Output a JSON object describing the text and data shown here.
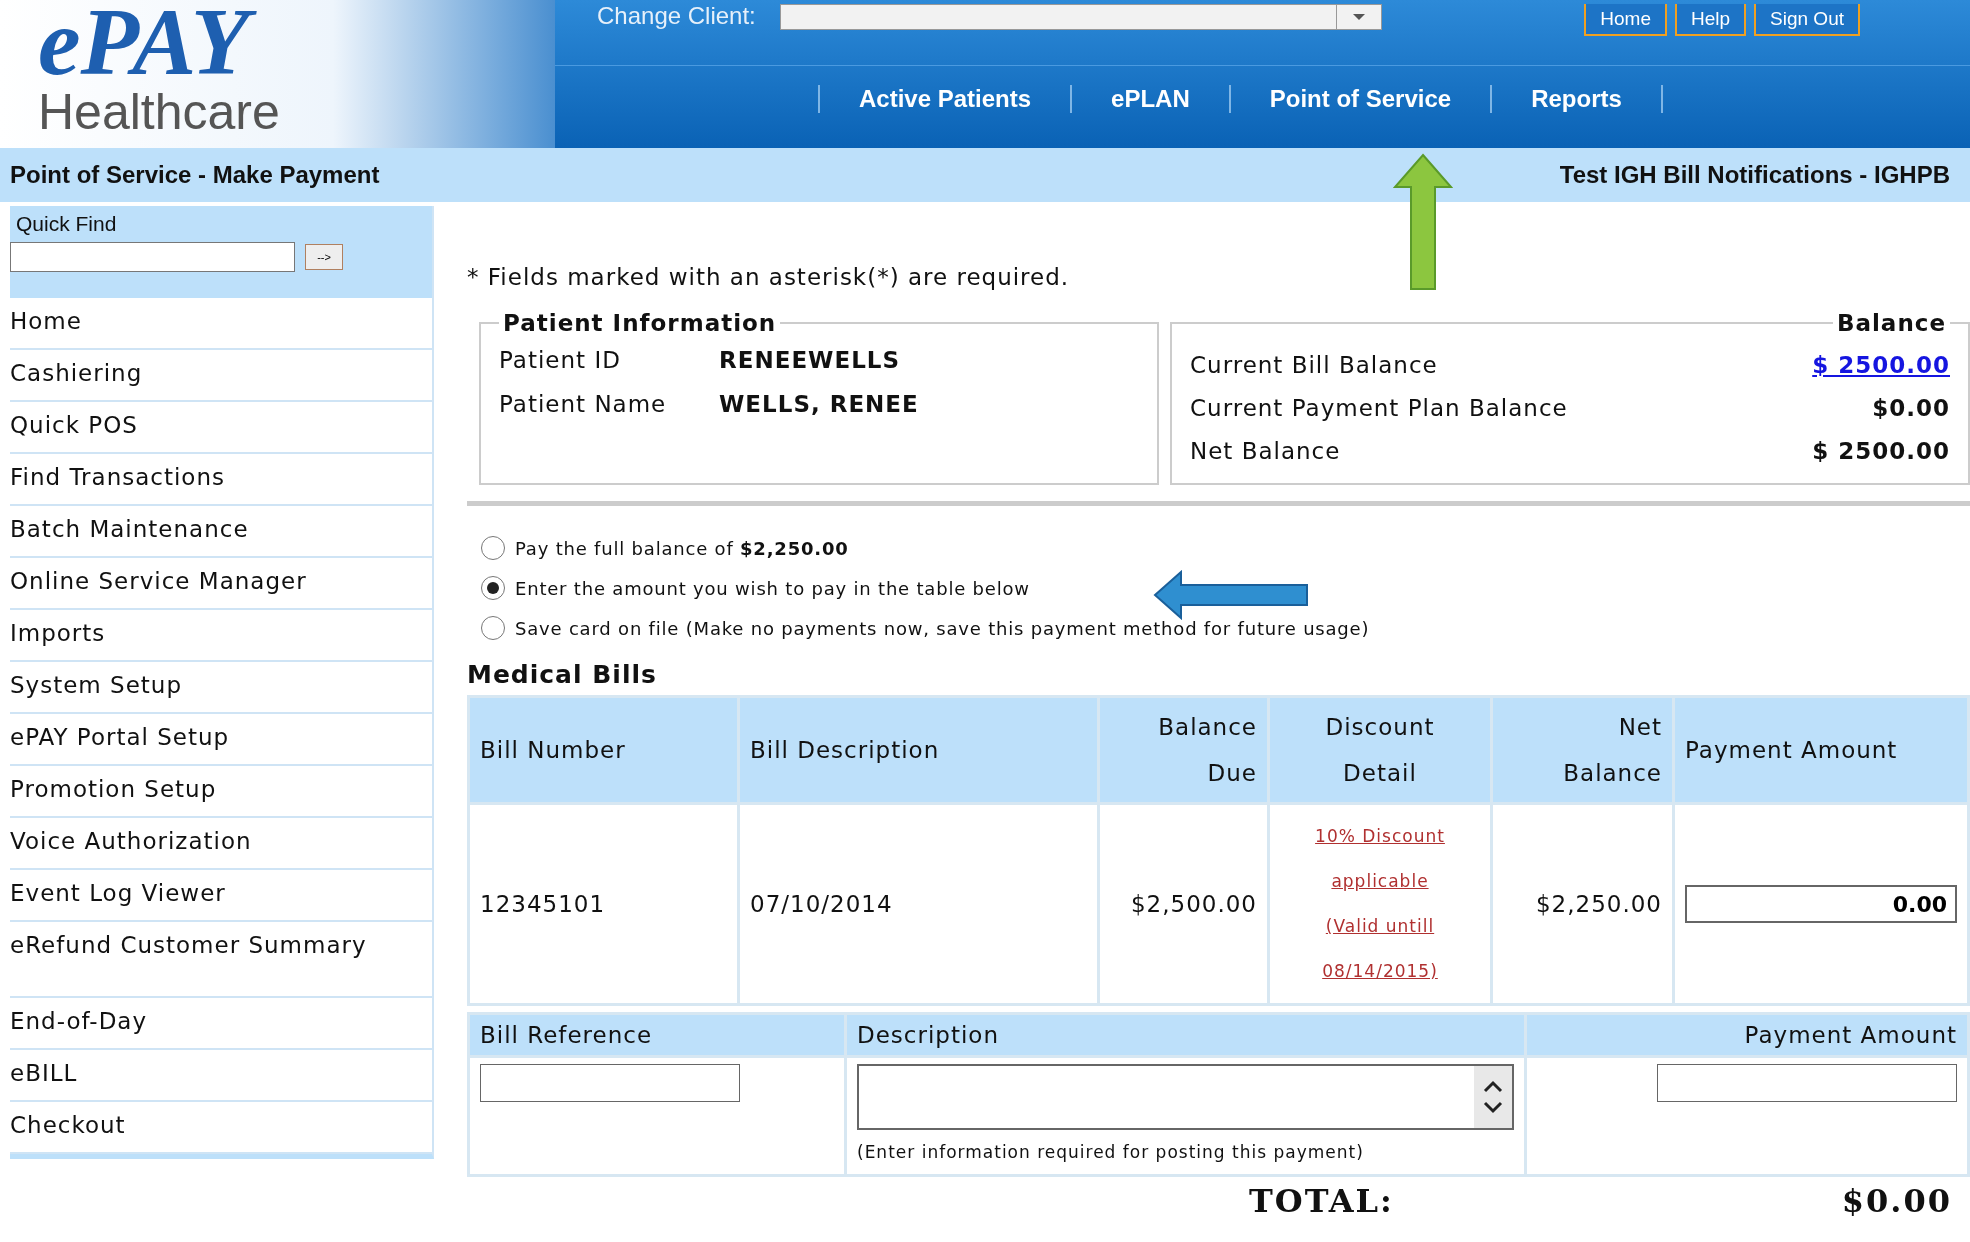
{
  "header": {
    "logo": {
      "brand": "ePAY",
      "tagline": "Healthcare"
    },
    "change_client": {
      "label": "Change Client:"
    },
    "top_buttons": [
      "Home",
      "Help",
      "Sign Out"
    ],
    "nav": [
      "Active Patients",
      "ePLAN",
      "Point of Service",
      "Reports"
    ]
  },
  "subheader": {
    "title": "Point of Service - Make Payment",
    "client": "Test IGH Bill Notifications - IGHPB"
  },
  "quick_find": {
    "label": "Quick Find",
    "button": "-->"
  },
  "sidebar": {
    "items": [
      "Home",
      "Cashiering",
      "Quick POS",
      "Find Transactions",
      "Batch Maintenance",
      "Online Service Manager",
      "Imports",
      "System Setup",
      "ePAY Portal Setup",
      "Promotion Setup",
      "Voice Authorization",
      "Event Log Viewer",
      "eRefund Customer Summary",
      "End-of-Day",
      "eBILL",
      "Checkout"
    ]
  },
  "required_note": "* Fields marked with an asterisk(*) are required.",
  "patient_info": {
    "legend": "Patient Information",
    "fields": [
      {
        "label": "Patient ID",
        "value": "RENEEWELLS"
      },
      {
        "label": "Patient Name",
        "value": "WELLS, RENEE"
      }
    ]
  },
  "balance": {
    "legend": "Balance",
    "rows": [
      {
        "label": "Current Bill Balance",
        "value": "$ 2500.00",
        "kind": "link"
      },
      {
        "label": "Current Payment Plan Balance",
        "value": "$0.00",
        "kind": "plain"
      },
      {
        "label": "Net Balance",
        "value": "$ 2500.00",
        "kind": "plain"
      }
    ]
  },
  "payment_options": [
    {
      "label": "Pay the full balance of **$2,250.00**",
      "selected": false
    },
    {
      "label": "Enter the amount you wish to pay in the table below",
      "selected": true
    },
    {
      "label": "Save card on file (Make no payments now, save this payment method for future usage)",
      "selected": false
    }
  ],
  "medical_bills": {
    "title": "Medical Bills",
    "columns": [
      "Bill Number",
      "Bill Description",
      "Balance Due",
      "Discount Detail",
      "Net Balance",
      "Payment Amount"
    ],
    "rows": [
      {
        "bill_number": "12345101",
        "bill_description": "07/10/2014",
        "balance_due": "$2,500.00",
        "discount_detail": "10% Discount applicable (Valid untill 08/14/2015)",
        "net_balance": "$2,250.00",
        "payment_amount": "0.00"
      }
    ]
  },
  "posting": {
    "columns": [
      "Bill Reference",
      "Description",
      "Payment Amount"
    ],
    "hint": "(Enter information required for posting this payment)"
  },
  "total": {
    "label": "TOTAL:",
    "value": "$0.00"
  }
}
